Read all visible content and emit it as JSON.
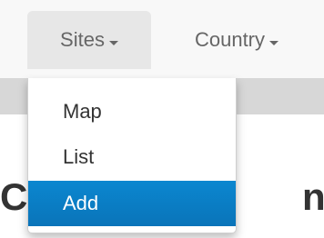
{
  "navbar": {
    "items": [
      {
        "label": "Sites",
        "active": true,
        "icon": "caret-down-icon"
      },
      {
        "label": "Country",
        "active": false,
        "icon": "caret-down-icon"
      }
    ]
  },
  "dropdown": {
    "items": [
      {
        "label": "Map",
        "highlighted": false
      },
      {
        "label": "List",
        "highlighted": false
      },
      {
        "label": "Add",
        "highlighted": true
      }
    ]
  },
  "background": {
    "heading_left": "C",
    "heading_right": "n"
  },
  "colors": {
    "navbar_bg": "#f8f8f8",
    "active_tab_bg": "#e7e7e7",
    "highlight_bg": "#0b7fc6",
    "highlight_text": "#ffffff"
  }
}
